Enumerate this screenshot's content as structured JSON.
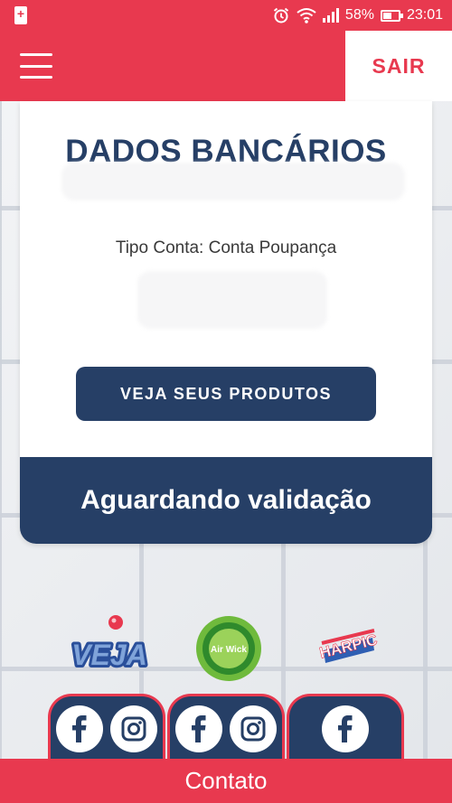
{
  "status_bar": {
    "battery_percent": "58%",
    "battery_level": 0.58,
    "time": "23:01",
    "icons": [
      "battery-saver-icon",
      "alarm-icon",
      "wifi-icon",
      "signal-icon",
      "battery-icon"
    ]
  },
  "header": {
    "menu_icon": "hamburger-menu-icon",
    "logout_label": "SAIR"
  },
  "card": {
    "title": "DADOS BANCÁRIOS",
    "account_type": "Tipo Conta: Conta Poupança",
    "products_button_label": "VEJA SEUS PRODUTOS",
    "status_text": "Aguardando validação"
  },
  "brands": {
    "veja": {
      "logo_text": "VEJA"
    },
    "airwick": {
      "logo_text": "Air Wick"
    },
    "harpic": {
      "logo_text": "HARPIC"
    }
  },
  "social": {
    "tabs": [
      {
        "brand": "veja",
        "icons": [
          "facebook-icon",
          "instagram-icon"
        ]
      },
      {
        "brand": "airwick",
        "icons": [
          "facebook-icon",
          "instagram-icon"
        ]
      },
      {
        "brand": "harpic",
        "icons": [
          "facebook-icon"
        ]
      }
    ]
  },
  "footer": {
    "contact_label": "Contato"
  },
  "colors": {
    "primary_red": "#e8394f",
    "navy": "#263f66",
    "white": "#ffffff"
  }
}
